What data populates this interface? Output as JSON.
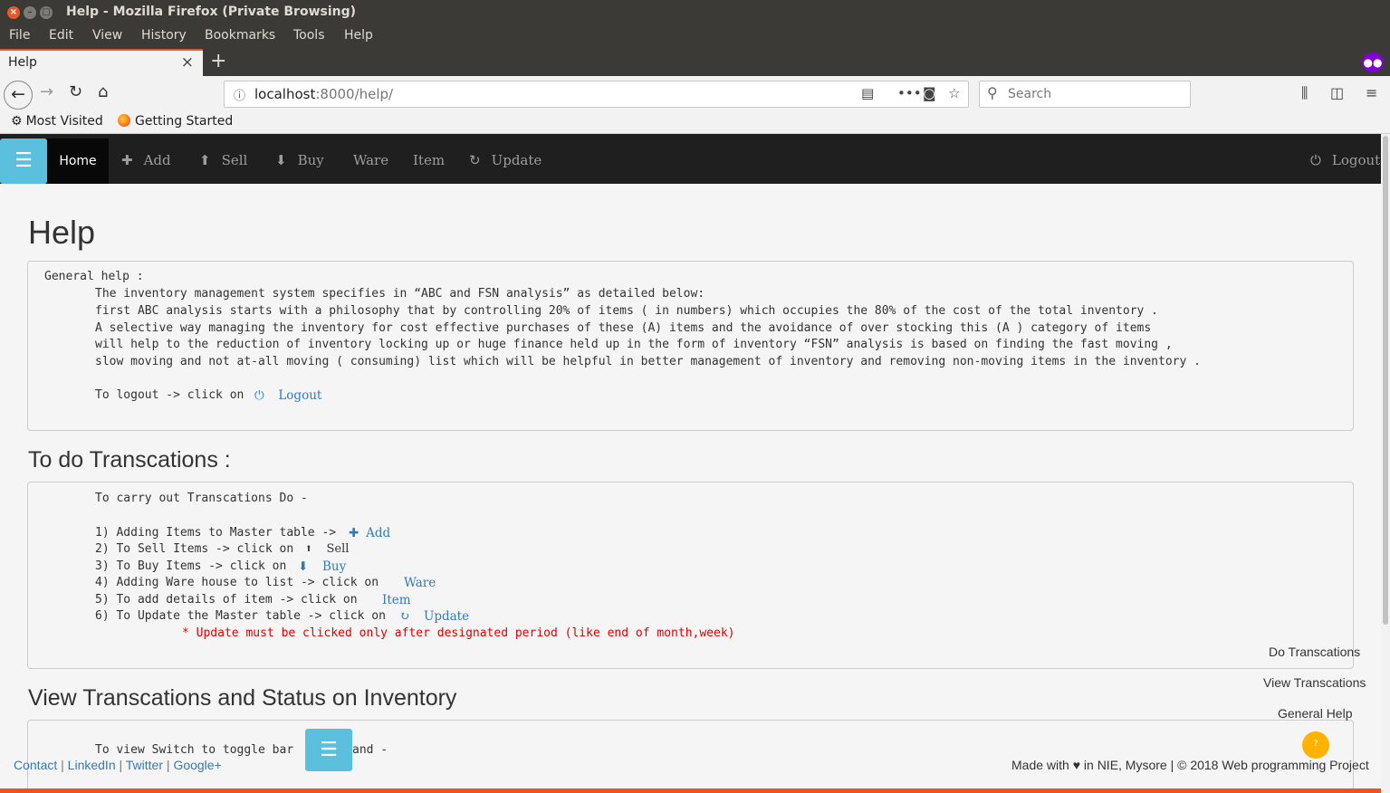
{
  "window": {
    "title": "Help - Mozilla Firefox (Private Browsing)",
    "menu": [
      "File",
      "Edit",
      "View",
      "History",
      "Bookmarks",
      "Tools",
      "Help"
    ]
  },
  "tab": {
    "label": "Help"
  },
  "urlbar": {
    "host": "localhost",
    "rest": ":8000/help/"
  },
  "search": {
    "placeholder": "Search"
  },
  "bookmarks": {
    "most_visited": "Most Visited",
    "getting_started": "Getting Started"
  },
  "appnav": {
    "home": "Home",
    "add": "Add",
    "sell": "Sell",
    "buy": "Buy",
    "ware": "Ware",
    "item": "Item",
    "update": "Update",
    "logout": "Logout"
  },
  "page": {
    "title": "Help",
    "general": {
      "heading": "General help :",
      "lines": [
        "The inventory management system specifies in “ABC and FSN analysis” as detailed below:",
        "first ABC analysis starts with a philosophy that by controlling 20% of items ( in numbers) which occupies the 80% of the cost of the total inventory .",
        "A selective way managing the inventory for cost effective purchases of these (A) items and the avoidance of over stocking this (A ) category of items",
        "will help to the reduction of inventory locking up or huge finance held up in the form of inventory “FSN” analysis is based on finding the fast moving ,",
        "slow moving and not at-all moving ( consuming) list which will be helpful in better management of inventory and removing non-moving items in the inventory ."
      ],
      "logout_line": "To logout -> click on",
      "logout_link": "Logout"
    },
    "transactions": {
      "heading": "To do Transcations :",
      "intro": "To carry out Transcations Do -",
      "steps": [
        {
          "text": "1) Adding Items to Master table ->",
          "link": "Add"
        },
        {
          "text": "2) To Sell Items -> click on",
          "link": "Sell"
        },
        {
          "text": "3) To Buy Items -> click on",
          "link": "Buy"
        },
        {
          "text": "4) Adding Ware house to list -> click on",
          "link": "Ware"
        },
        {
          "text": "5) To add details of item -> click on",
          "link": "Item"
        },
        {
          "text": "6) To Update the Master table -> click on",
          "link": "Update"
        }
      ],
      "note": "* Update must be clicked only after designated period (like end of month,week)"
    },
    "view": {
      "heading": "View Transcations and Status on Inventory",
      "line_a": "To view Switch to toggle bar",
      "line_b": "and -"
    }
  },
  "right_nav": [
    "Do Transcations",
    "View Transcations",
    "General Help"
  ],
  "fab": {
    "label": "?"
  },
  "footer": {
    "links": [
      "Contact",
      "LinkedIn",
      "Twitter",
      "Google+"
    ],
    "made_with": "Made with",
    "right": "in NIE, Mysore | © 2018 Web programming Project"
  }
}
